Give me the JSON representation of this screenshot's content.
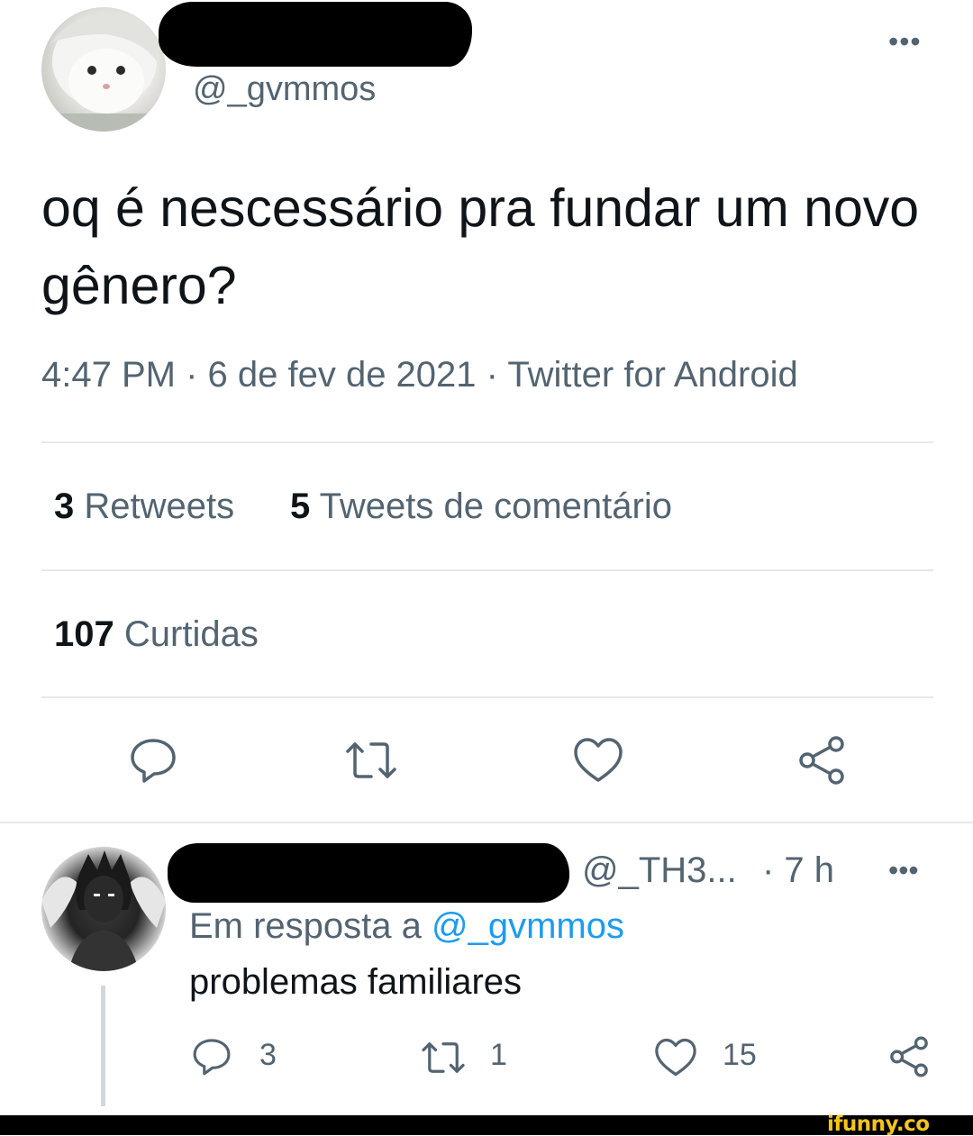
{
  "tweet": {
    "handle": "@_gvmmos",
    "more": "•••",
    "text": "oq é nescessário pra fundar um novo gênero?",
    "meta": "4:47 PM · 6 de fev de 2021 · Twitter for Android",
    "retweets_count": "3",
    "retweets_label": "Retweets",
    "quotes_count": "5",
    "quotes_label": "Tweets de comentário",
    "likes_count": "107",
    "likes_label": "Curtidas"
  },
  "reply": {
    "handle": "@_TH3...",
    "time": "· 7 h",
    "more": "•••",
    "reply_prefix": "Em resposta a ",
    "reply_to": "@_gvmmos",
    "text": "problemas familiares",
    "reply_count": "3",
    "retweet_count": "1",
    "like_count": "15"
  },
  "icons": [
    "comment-icon",
    "retweet-icon",
    "heart-icon",
    "share-icon"
  ],
  "colors": {
    "text": "#0f1419",
    "muted": "#536471",
    "link": "#1d9bf0",
    "divider": "#e6e9eb"
  },
  "watermark": "ifunny.co"
}
